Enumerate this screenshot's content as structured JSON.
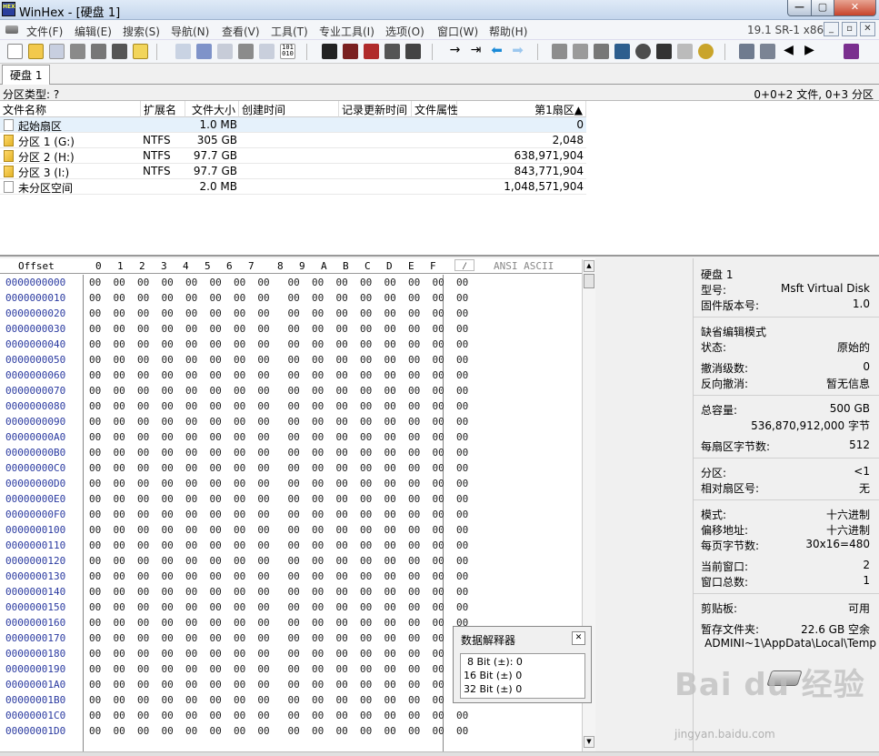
{
  "window": {
    "title": "WinHex - [硬盘 1]",
    "app_icon": "HEX",
    "minimize": "—",
    "maximize": "▢",
    "close": "✕"
  },
  "menu": {
    "items": [
      "文件(F)",
      "编辑(E)",
      "搜索(S)",
      "导航(N)",
      "查看(V)",
      "工具(T)",
      "专业工具(I)",
      "选项(O)",
      "窗口(W)",
      "帮助(H)"
    ],
    "version": "19.1 SR-1 x86"
  },
  "toolbar": {
    "icons": [
      "new-file-icon",
      "open-file-icon",
      "save-icon",
      "print-icon",
      "print-preview-icon",
      "properties-icon",
      "open-disk-icon",
      "undo-icon",
      "copy-icon",
      "cut-icon",
      "paste-icon",
      "paste-clipboard-icon",
      "hex-binary-icon",
      "find-text-icon",
      "find-hex-icon",
      "replace-text-icon",
      "replace-hex-icon",
      "find-hex-value-icon",
      "goto-offset-icon",
      "goto-sector-icon",
      "back-arrow-icon",
      "forward-arrow-icon",
      "open-drive-icon",
      "clone-disk-icon",
      "disk-image-icon",
      "ram-icon",
      "zoom-icon",
      "recover-icon",
      "tools-icon",
      "gear-icon",
      "calculator-icon",
      "table-icon",
      "prev-icon",
      "next-icon",
      "book-icon"
    ]
  },
  "tabs": [
    {
      "label": "硬盘 1"
    }
  ],
  "partition_bar": {
    "type_label": "分区类型: ?",
    "summary": "0+0+2 文件, 0+3 分区"
  },
  "file_list": {
    "columns": [
      "文件名称",
      "扩展名",
      "文件大小",
      "创建时间",
      "记录更新时间",
      "文件属性",
      "第1扇区▲"
    ],
    "rows": [
      {
        "name": "起始扇区",
        "ext": "",
        "size": "1.0 MB",
        "sector": "0",
        "selected": true
      },
      {
        "name": "分区 1 (G:)",
        "ext": "NTFS",
        "size": "305 GB",
        "sector": "2,048",
        "selected": false
      },
      {
        "name": "分区 2 (H:)",
        "ext": "NTFS",
        "size": "97.7 GB",
        "sector": "638,971,904",
        "selected": false
      },
      {
        "name": "分区 3 (I:)",
        "ext": "NTFS",
        "size": "97.7 GB",
        "sector": "843,771,904",
        "selected": false
      },
      {
        "name": "未分区空间",
        "ext": "",
        "size": "2.0 MB",
        "sector": "1,048,571,904",
        "selected": false
      }
    ]
  },
  "hex": {
    "offset_label": "Offset",
    "columns": [
      "0",
      "1",
      "2",
      "3",
      "4",
      "5",
      "6",
      "7",
      "8",
      "9",
      "A",
      "B",
      "C",
      "D",
      "E",
      "F"
    ],
    "ascii_tab": "⁄",
    "ascii_label": "ANSI ASCII",
    "byte_value": "00",
    "offsets": [
      "0000000000",
      "0000000010",
      "0000000020",
      "0000000030",
      "0000000040",
      "0000000050",
      "0000000060",
      "0000000070",
      "0000000080",
      "0000000090",
      "00000000A0",
      "00000000B0",
      "00000000C0",
      "00000000D0",
      "00000000E0",
      "00000000F0",
      "0000000100",
      "0000000110",
      "0000000120",
      "0000000130",
      "0000000140",
      "0000000150",
      "0000000160",
      "0000000170",
      "0000000180",
      "0000000190",
      "00000001A0",
      "00000001B0",
      "00000001C0",
      "00000001D0"
    ],
    "scroll_up": "▲",
    "scroll_down": "▼"
  },
  "data_interpreter": {
    "title": "数据解释器",
    "close": "✕",
    "lines": [
      "8 Bit (±): 0",
      "16 Bit (±) 0",
      "32 Bit (±) 0"
    ]
  },
  "info": {
    "disk": "硬盘 1",
    "model_label": "型号:",
    "model": "Msft Virtual Disk",
    "firmware_label": "固件版本号:",
    "firmware": "1.0",
    "edit_mode_label": "缺省编辑模式",
    "state_label": "状态:",
    "state": "原始的",
    "undo_label": "撤消级数:",
    "undo": "0",
    "reverse_undo_label": "反向撤消:",
    "reverse_undo": "暂无信息",
    "capacity_label": "总容量:",
    "capacity": "500 GB",
    "capacity_bytes": "536,870,912,000 字节",
    "bps_label": "每扇区字节数:",
    "bps": "512",
    "partition_label": "分区:",
    "partition": "<1",
    "rel_sector_label": "相对扇区号:",
    "rel_sector": "无",
    "mode_label": "模式:",
    "mode": "十六进制",
    "offset_label": "偏移地址:",
    "offset": "十六进制",
    "bpp_label": "每页字节数:",
    "bpp": "30x16=480",
    "cur_window_label": "当前窗口:",
    "cur_window": "2",
    "total_windows_label": "窗口总数:",
    "total_windows": "1",
    "clipboard_label": "剪贴板:",
    "clipboard": "可用",
    "temp_label": "暂存文件夹:",
    "temp": "22.6 GB 空余",
    "temp_path": "ADMINI~1\\AppData\\Local\\Temp"
  },
  "watermark": {
    "text": "Bai du 经验",
    "sub": "jingyan.baidu.com"
  }
}
